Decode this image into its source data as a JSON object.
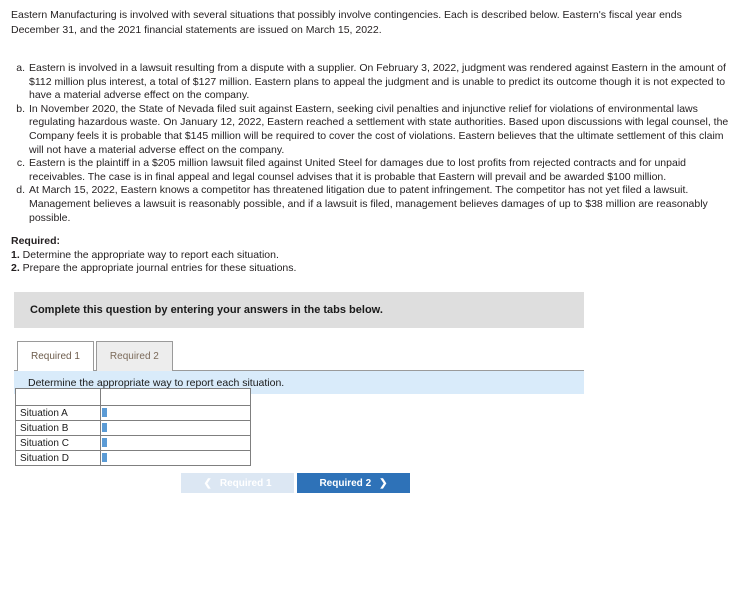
{
  "intro": {
    "paragraph": "Eastern Manufacturing is involved with several situations that possibly involve contingencies. Each is described below. Eastern's fiscal year ends December 31, and the 2021 financial statements are issued on March 15, 2022."
  },
  "situations": [
    {
      "marker": "a.",
      "text": "Eastern is involved in a lawsuit resulting from a dispute with a supplier. On February 3, 2022, judgment was rendered against Eastern in the amount of $112 million plus interest, a total of $127 million. Eastern plans to appeal the judgment and is unable to predict its outcome though it is not expected to have a material adverse effect on the company."
    },
    {
      "marker": "b.",
      "text": "In November 2020, the State of Nevada filed suit against Eastern, seeking civil penalties and injunctive relief for violations of environmental laws regulating hazardous waste. On January 12, 2022, Eastern reached a settlement with state authorities. Based upon discussions with legal counsel, the Company feels it is probable that $145 million will be required to cover the cost of violations. Eastern believes that the ultimate settlement of this claim will not have a material adverse effect on the company."
    },
    {
      "marker": "c.",
      "text": "Eastern is the plaintiff in a $205 million lawsuit filed against United Steel for damages due to lost profits from rejected contracts and for unpaid receivables. The case is in final appeal and legal counsel advises that it is probable that Eastern will prevail and be awarded $100 million."
    },
    {
      "marker": "d.",
      "text": "At March 15, 2022, Eastern knows a competitor has threatened litigation due to patent infringement. The competitor has not yet filed a lawsuit. Management believes a lawsuit is reasonably possible, and if a lawsuit is filed, management believes damages of up to $38 million are reasonably possible."
    }
  ],
  "required": {
    "title": "Required:",
    "items": [
      {
        "num": "1.",
        "text": " Determine the appropriate way to report each situation."
      },
      {
        "num": "2.",
        "text": " Prepare the appropriate journal entries for these situations."
      }
    ]
  },
  "panel": {
    "banner": "Complete this question by entering your answers in the tabs below.",
    "tabs": [
      {
        "label": "Required 1",
        "active": true
      },
      {
        "label": "Required 2",
        "active": false
      }
    ],
    "infobar": "Determine the appropriate way to report each situation."
  },
  "answer_table": {
    "header": [
      "",
      ""
    ],
    "rows": [
      {
        "label": "Situation A",
        "value": ""
      },
      {
        "label": "Situation B",
        "value": ""
      },
      {
        "label": "Situation C",
        "value": ""
      },
      {
        "label": "Situation D",
        "value": ""
      }
    ]
  },
  "nav": {
    "prev_label": "Required 1",
    "next_label": "Required 2",
    "prev_chevron": "❮",
    "next_chevron": "❯"
  },
  "colors": {
    "banner_gray": "#dedede",
    "infobar_blue": "#d9ebfa",
    "table_header_blue": "#6ba4da",
    "btn_next_blue": "#2e72b8",
    "btn_prev_light": "#dce7f3"
  }
}
